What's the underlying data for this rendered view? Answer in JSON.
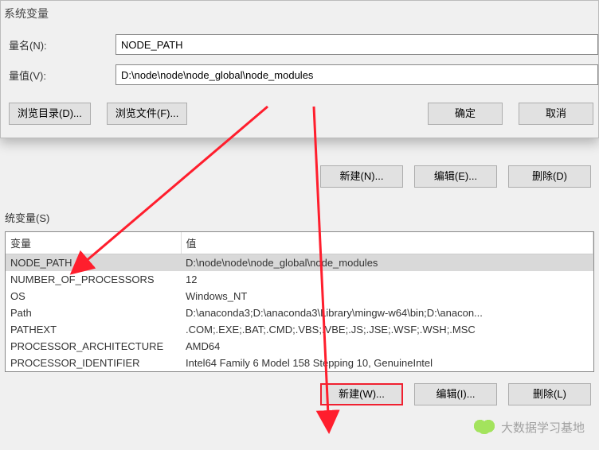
{
  "edit_dialog": {
    "title": "系统变量",
    "name_label": "量名(N):",
    "name_value": "NODE_PATH",
    "value_label": "量值(V):",
    "value_value": "D:\\node\\node\\node_global\\node_modules",
    "browse_dir": "浏览目录(D)...",
    "browse_file": "浏览文件(F)...",
    "ok": "确定",
    "cancel": "取消"
  },
  "env_dialog": {
    "upper_new": "新建(N)...",
    "upper_edit": "编辑(E)...",
    "upper_delete": "删除(D)",
    "group_label": "统变量(S)",
    "col_var": "变量",
    "col_val": "值",
    "rows": [
      {
        "name": "NODE_PATH",
        "value": "D:\\node\\node\\node_global\\node_modules",
        "selected": true
      },
      {
        "name": "NUMBER_OF_PROCESSORS",
        "value": "12"
      },
      {
        "name": "OS",
        "value": "Windows_NT"
      },
      {
        "name": "Path",
        "value": "D:\\anaconda3;D:\\anaconda3\\Library\\mingw-w64\\bin;D:\\anacon..."
      },
      {
        "name": "PATHEXT",
        "value": ".COM;.EXE;.BAT;.CMD;.VBS;.VBE;.JS;.JSE;.WSF;.WSH;.MSC"
      },
      {
        "name": "PROCESSOR_ARCHITECTURE",
        "value": "AMD64"
      },
      {
        "name": "PROCESSOR_IDENTIFIER",
        "value": "Intel64 Family 6 Model 158 Stepping 10, GenuineIntel"
      }
    ],
    "lower_new": "新建(W)...",
    "lower_edit": "编辑(I)...",
    "lower_delete": "删除(L)"
  },
  "watermark_text": "大数据学习基地"
}
